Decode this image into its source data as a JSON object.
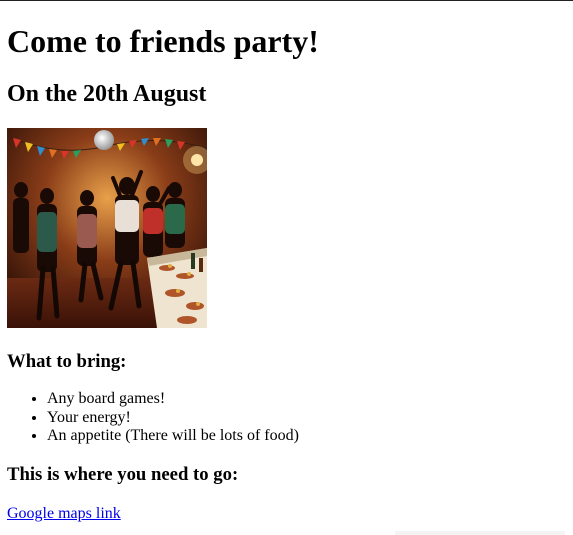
{
  "page": {
    "title": "Come to friends party!",
    "date_heading": "On the 20th August",
    "bring_heading": "What to bring:",
    "bring_items": [
      "Any board games!",
      "Your energy!",
      "An appetite (There will be lots of food)"
    ],
    "where_heading": "This is where you need to go:",
    "maps_link_label": "Google maps link"
  },
  "colors": {
    "link": "#0000ee",
    "text": "#000000",
    "background": "#ffffff"
  }
}
